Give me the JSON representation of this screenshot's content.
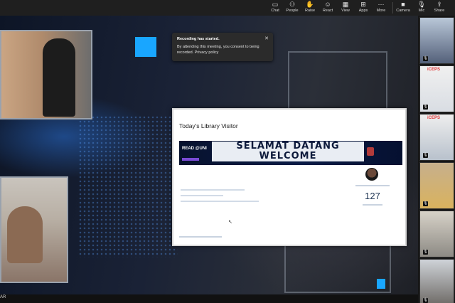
{
  "toolbar": {
    "buttons": [
      {
        "label": "Chat",
        "icon": "chat-icon"
      },
      {
        "label": "People",
        "icon": "people-icon"
      },
      {
        "label": "Raise",
        "icon": "raise-hand-icon"
      },
      {
        "label": "React",
        "icon": "react-icon"
      },
      {
        "label": "View",
        "icon": "view-icon"
      },
      {
        "label": "Apps",
        "icon": "apps-icon"
      },
      {
        "label": "More",
        "icon": "more-icon"
      },
      {
        "label": "Camera",
        "icon": "camera-icon"
      },
      {
        "label": "Mic",
        "icon": "mic-off-icon"
      },
      {
        "label": "Share",
        "icon": "share-icon"
      }
    ]
  },
  "notification": {
    "title": "Recording has started.",
    "body": "By attending this meeting, you consent to being recorded. Privacy policy",
    "close_symbol": "✕"
  },
  "slide": {
    "title": "Today's Library Visitor",
    "banner": {
      "read": "READ @UNI",
      "line1": "SELAMAT DATANG",
      "line2": "WELCOME"
    },
    "visitor_count": "127"
  },
  "participants": {
    "brand_label": "iCEPS"
  },
  "bottom_bar": {
    "name_fragment": "AR"
  },
  "colors": {
    "toolbar_bg": "#1f1f1f",
    "stage_bg": "#1a2236",
    "accent_cyan": "#18a9ff",
    "banner_navy": "#0a1b46",
    "brand_red": "#e03a3a"
  }
}
